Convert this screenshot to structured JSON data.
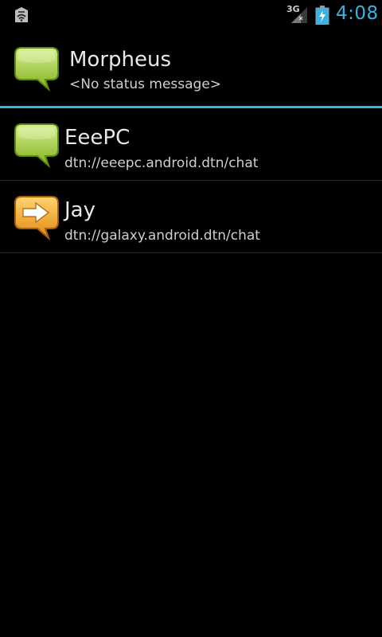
{
  "status_bar": {
    "network_type": "3G",
    "time": "4:08",
    "app_icon": "dtn-notification-icon",
    "signal_icon": "signal-icon",
    "battery_icon": "battery-charging-icon",
    "accent_color": "#33b5e5"
  },
  "profile": {
    "name": "Morpheus",
    "status": "<No status message>",
    "presence_icon": "green-chat-bubble-icon",
    "presence_color": "#9ccc3c"
  },
  "buddies": [
    {
      "name": "EeePC",
      "address": "dtn://eeepc.android.dtn/chat",
      "presence_icon": "green-chat-bubble-icon",
      "presence_color": "#9ccc3c"
    },
    {
      "name": "Jay",
      "address": "dtn://galaxy.android.dtn/chat",
      "presence_icon": "orange-arrow-bubble-icon",
      "presence_color": "#f0a92e"
    }
  ]
}
